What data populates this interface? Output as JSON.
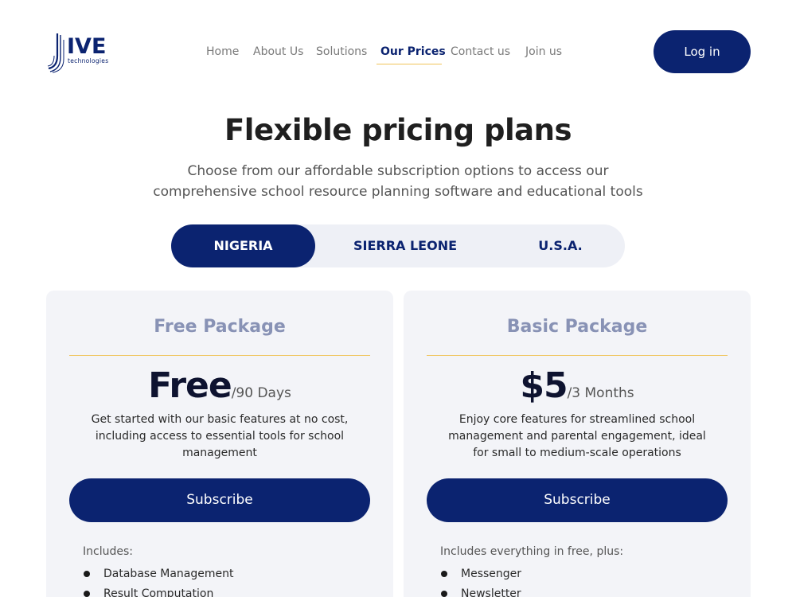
{
  "logo": {
    "main": "IVE",
    "sub": "technologies"
  },
  "nav": {
    "items": [
      {
        "label": "Home"
      },
      {
        "label": "About Us"
      },
      {
        "label": "Solutions"
      },
      {
        "label": "Our Prices"
      },
      {
        "label": "Contact us"
      },
      {
        "label": "Join us"
      }
    ],
    "active": "Our Prices"
  },
  "header": {
    "login_label": "Log in"
  },
  "hero": {
    "title": "Flexible pricing plans",
    "subtitle_line1": "Choose from our affordable subscription options to access our",
    "subtitle_line2": "comprehensive school resource planning software and educational tools"
  },
  "countries": {
    "options": [
      "NIGERIA",
      "SIERRA LEONE",
      "U.S.A."
    ],
    "selected": "NIGERIA"
  },
  "plans": [
    {
      "title": "Free Package",
      "price": "Free",
      "period": "/90 Days",
      "description": "Get started with our basic features at no cost, including access to essential tools for school management",
      "subscribe_label": "Subscribe",
      "includes_label": "Includes:",
      "features": [
        "Database Management",
        "Result Computation"
      ]
    },
    {
      "title": "Basic Package",
      "price": "$5",
      "period": "/3 Months",
      "description": "Enjoy core features for streamlined school management and parental engagement, ideal for small to medium-scale operations",
      "subscribe_label": "Subscribe",
      "includes_label": "Includes everything in free, plus:",
      "features": [
        "Messenger",
        "Newsletter"
      ]
    }
  ],
  "colors": {
    "brand": "#0b2370",
    "accent_line": "#f0c45a",
    "card_bg": "#f3f4f8",
    "card_title": "#8892b5"
  }
}
